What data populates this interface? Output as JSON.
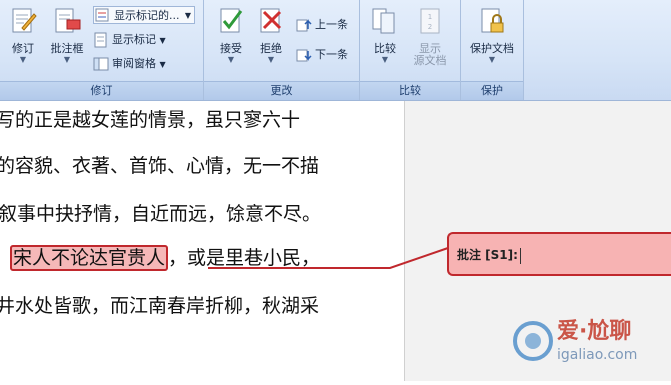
{
  "ribbon": {
    "group_tracking": {
      "label": "修订",
      "track_changes": "修订",
      "new_comment": "批注框",
      "show_markup_combo": "显示标记的...",
      "show_markup": "显示标记",
      "reviewing_pane": "审阅窗格"
    },
    "group_changes": {
      "label": "更改",
      "accept": "接受",
      "reject": "拒绝",
      "previous": "上一条",
      "next": "下一条"
    },
    "group_compare": {
      "label": "比较",
      "compare": "比较",
      "show_source_1": "显示",
      "show_source_2": "源文档"
    },
    "group_protect": {
      "label": "保护",
      "protect_document": "保护文档"
    }
  },
  "document": {
    "line1": "写的正是越女莲的情景，虽只寥六十",
    "line2": "的容貌、衣著、首饰、心情，无一不描",
    "line3": "叙事中抉抒情，自近而远，馀意不尽。",
    "line4_highlight": "宋人不论达官贵人",
    "line4_rest": "，或是里巷小民，",
    "line5": "井水处皆歌，而江南春岸折柳，秋湖采"
  },
  "comment": {
    "label": "批注 [S1]:"
  },
  "watermark": {
    "line1": "爱·尬聊",
    "line2": "igaliao.com"
  },
  "colors": {
    "ribbon_bg": "#d6e4f7",
    "comment_fill": "#f7b3b3",
    "comment_border": "#c0282d",
    "highlight": "#f5b8b8"
  }
}
